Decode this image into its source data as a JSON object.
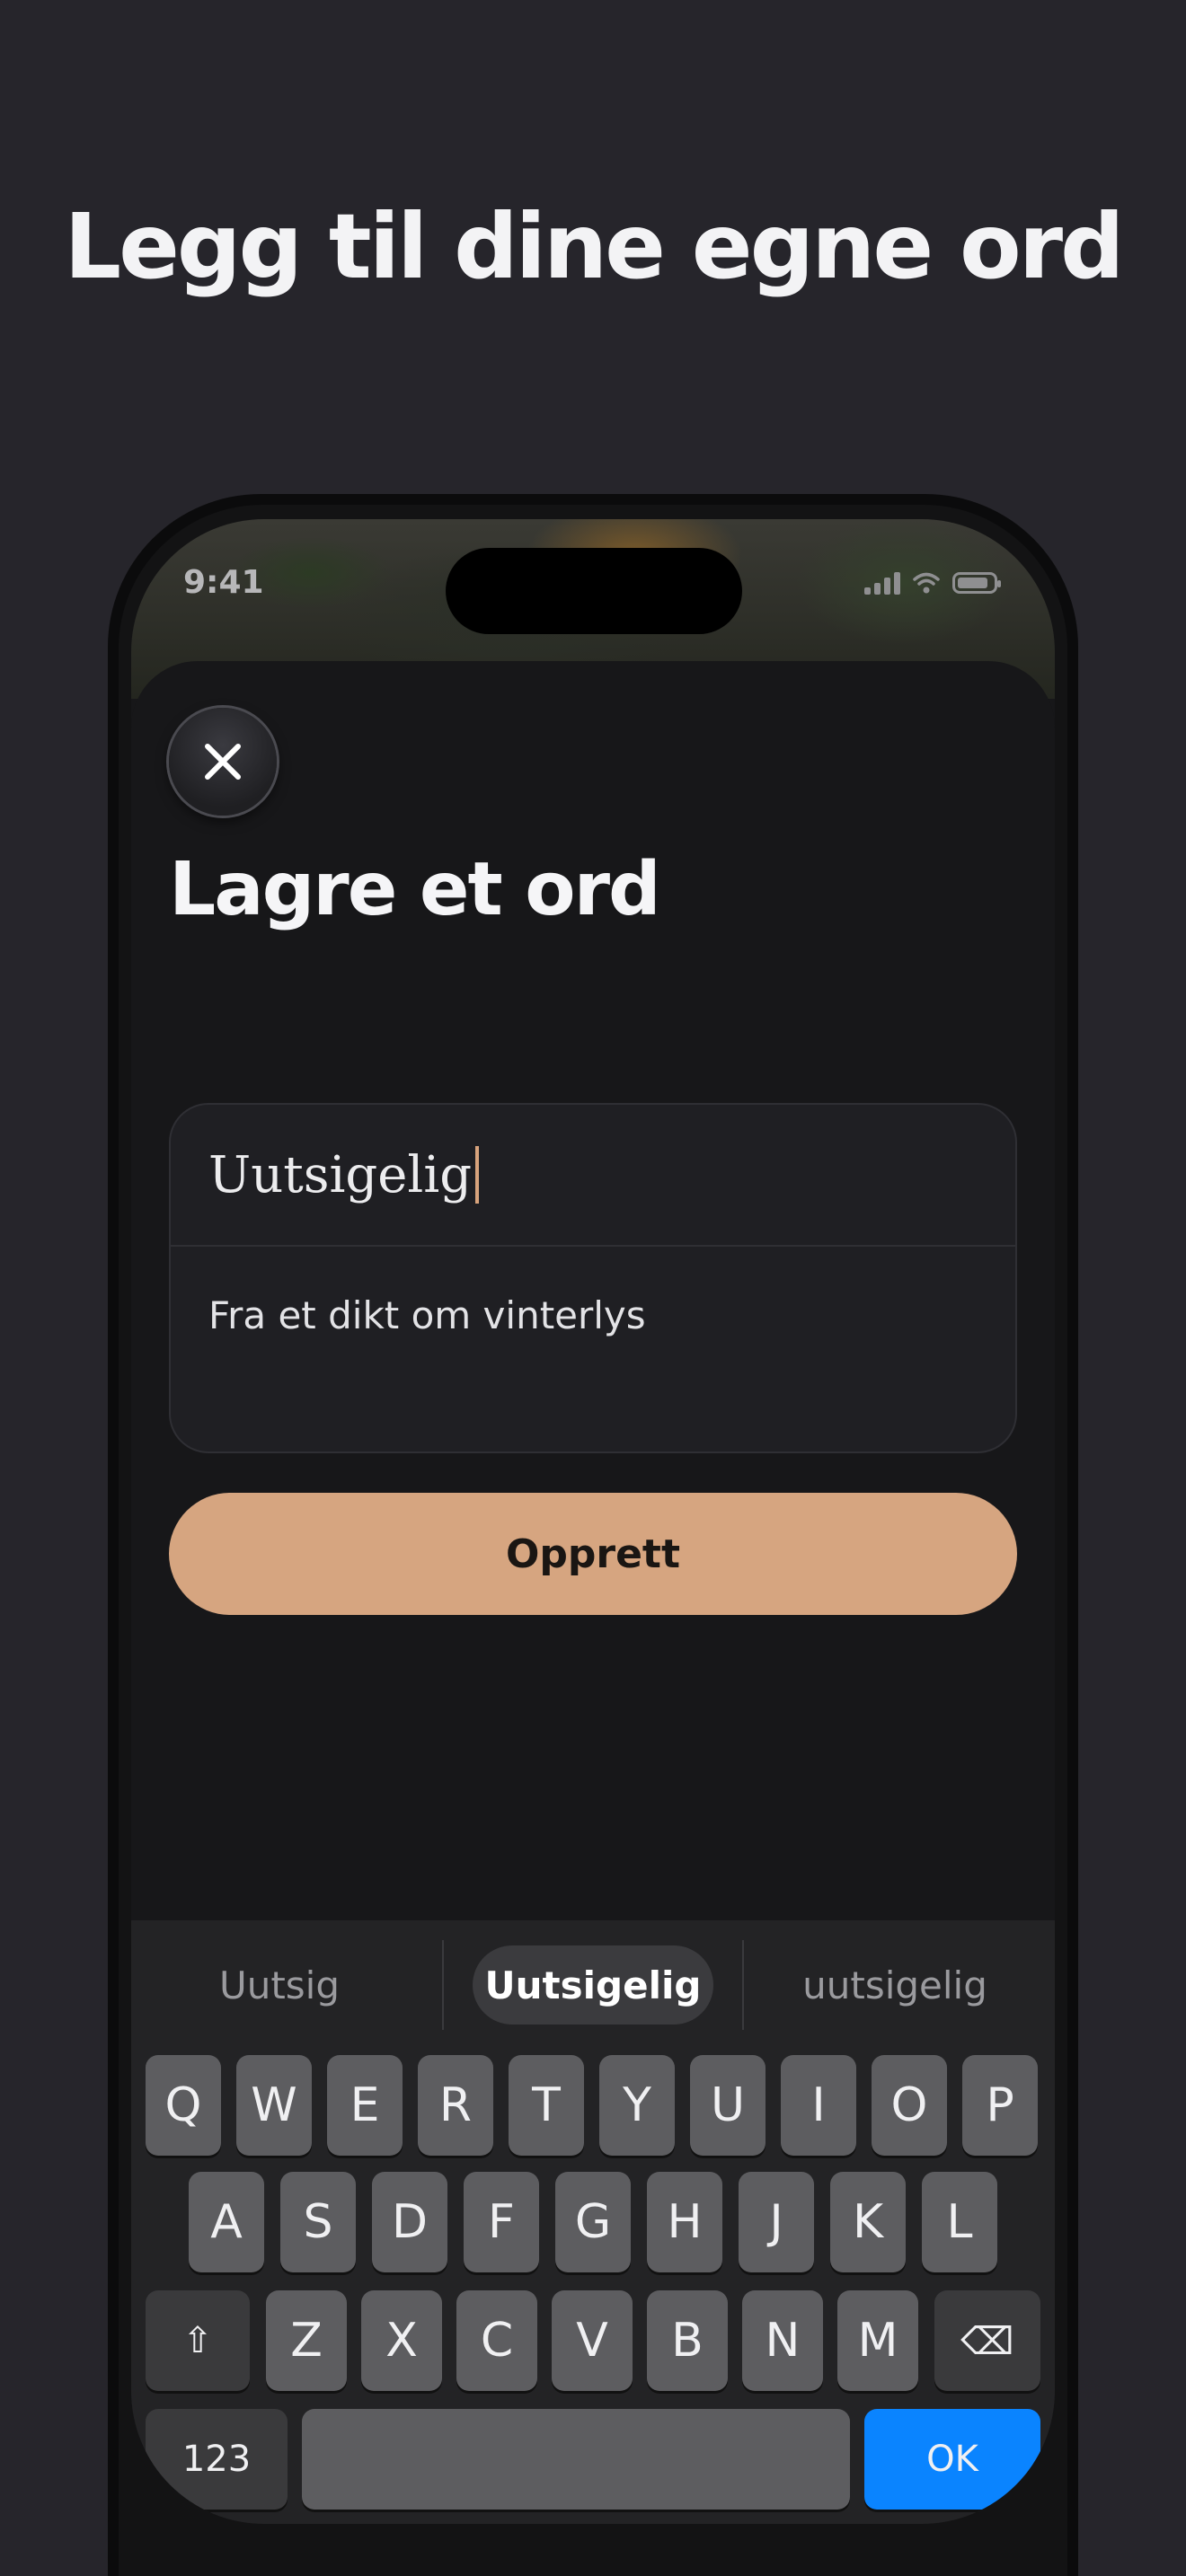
{
  "headline": "Legg til dine egne ord",
  "status_bar": {
    "time": "9:41"
  },
  "sheet": {
    "title": "Lagre et ord",
    "word_value": "Uutsigelig",
    "note_value": "Fra et dikt om vinterlys",
    "create_label": "Opprett"
  },
  "keyboard": {
    "suggestions": [
      "Uutsig",
      "Uutsigelig",
      "uutsigelig"
    ],
    "row1": [
      "Q",
      "W",
      "E",
      "R",
      "T",
      "Y",
      "U",
      "I",
      "O",
      "P"
    ],
    "row2": [
      "A",
      "S",
      "D",
      "F",
      "G",
      "H",
      "J",
      "K",
      "L"
    ],
    "row3": [
      "Z",
      "X",
      "C",
      "V",
      "B",
      "N",
      "M"
    ],
    "shift": "⇧",
    "backspace": "⌫",
    "numbers": "123",
    "ok": "OK"
  },
  "colors": {
    "accent": "#d6a580",
    "background": "#26252b",
    "keyboard_ok": "#0a84ff",
    "caret": "#d8a37c"
  }
}
